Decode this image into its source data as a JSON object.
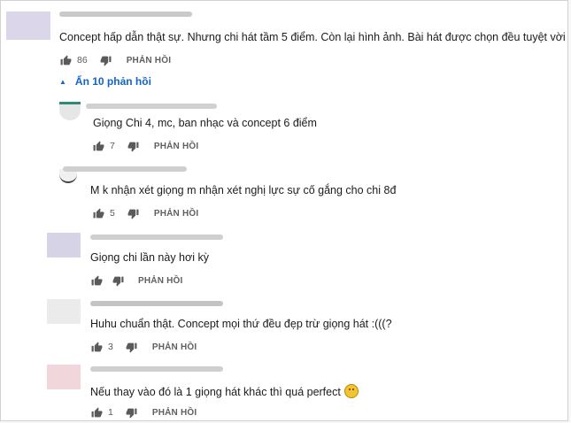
{
  "top_comment": {
    "text": "Concept hấp dẫn thật sự. Nhưng chi hát tầm 5 điểm. Còn lại hình ảnh. Bài hát được chọn đều tuyệt vời",
    "likes": "86",
    "reply_label": "PHẢN HỒI"
  },
  "toggle": {
    "label": "Ẩn 10 phản hồi",
    "icon": "caret-up-icon",
    "color": "#1463c7"
  },
  "replies": [
    {
      "text": "Giọng Chi 4, mc, ban nhạc và concept 6 điểm",
      "likes": "7",
      "reply_label": "PHẢN HỒI"
    },
    {
      "text": "M k nhận xét giọng m nhận xét nghị lực sự cố gắng cho chi 8đ",
      "likes": "5",
      "reply_label": "PHẢN HỒI"
    },
    {
      "text": "Giọng chi lần này  hơi  kỳ",
      "likes": "",
      "reply_label": "PHẢN HỒI"
    },
    {
      "text": "Huhu chuẩn thật. Concept mọi thứ đều đẹp trừ giọng hát :(((?",
      "likes": "3",
      "reply_label": "PHẢN HỒI"
    },
    {
      "text": "Nếu thay vào đó là 1 giọng hát khác thì quá perfect",
      "likes": "1",
      "reply_label": "PHẢN HỒI",
      "emoji": "grimacing-face-emoji"
    }
  ],
  "icons": {
    "like": "thumbs-up-icon",
    "dislike": "thumbs-down-icon"
  }
}
